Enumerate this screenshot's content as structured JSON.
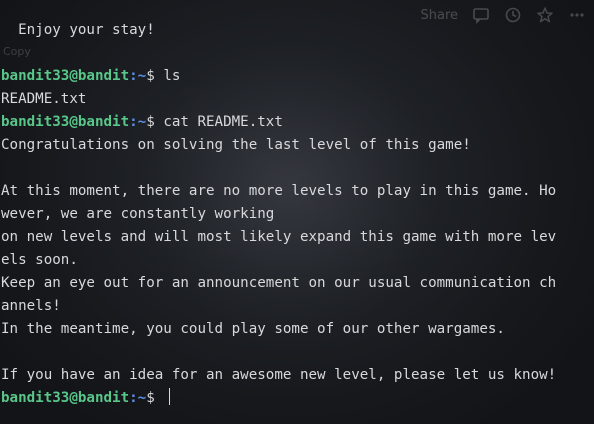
{
  "overlay": {
    "share_label": "Share",
    "icons": [
      "comment-icon",
      "history-icon",
      "star-icon",
      "more-icon"
    ],
    "copy_label": "Copy"
  },
  "terminal": {
    "prompt": {
      "user_host": "bandit33@bandit",
      "path": ":~",
      "symbol": "$ "
    },
    "colors": {
      "background": "#1e2126",
      "text": "#d7d9dc",
      "prompt_user": "#59c68a",
      "prompt_path": "#5c8fe6"
    },
    "lines": {
      "l0": "  Enjoy your stay!",
      "l3_cmd": "ls",
      "l4": "README.txt",
      "l5_cmd": "cat README.txt",
      "l6": "Congratulations on solving the last level of this game!",
      "l7": "",
      "l8": "At this moment, there are no more levels to play in this game. Ho",
      "l9": "wever, we are constantly working",
      "l10": "on new levels and will most likely expand this game with more lev",
      "l11": "els soon.",
      "l12": "Keep an eye out for an announcement on our usual communication ch",
      "l13": "annels!",
      "l14": "In the meantime, you could play some of our other wargames.",
      "l15": "",
      "l16": "If you have an idea for an awesome new level, please let us know!"
    }
  }
}
